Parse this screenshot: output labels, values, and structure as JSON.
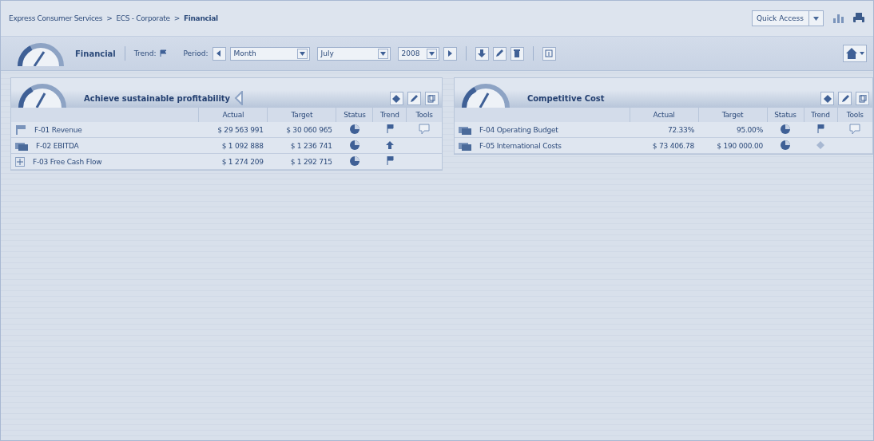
{
  "breadcrumb": {
    "items": [
      {
        "label": "Express Consumer Services",
        "current": false
      },
      {
        "label": "ECS - Corporate",
        "current": false
      },
      {
        "label": "Financial",
        "current": true
      }
    ],
    "separators": [
      ">",
      ">"
    ]
  },
  "quick_access": {
    "value": "Quick Access"
  },
  "toolbar": {
    "title": "Financial",
    "trend_label": "Trend:",
    "period_label": "Period:",
    "selects": [
      {
        "value": "Month"
      },
      {
        "value": "July"
      },
      {
        "value": "2008"
      }
    ]
  },
  "panels": [
    {
      "title": "Achieve sustainable profitability",
      "collapse_arrow": true,
      "columns": [
        "Actual",
        "Target",
        "Status",
        "Trend",
        "Tools"
      ],
      "rows": [
        {
          "name": "F-01 Revenue",
          "actual": "$ 29 563 991",
          "target": "$ 30 060 965",
          "comment": true
        },
        {
          "name": "F-02 EBITDA",
          "actual": "$ 1 092 888",
          "target": "$ 1 236 741",
          "comment": false
        },
        {
          "name": "F-03 Free Cash Flow",
          "actual": "$ 1 274 209",
          "target": "$ 1 292 715",
          "comment": false
        }
      ]
    },
    {
      "title": "Competitive Cost",
      "collapse_arrow": false,
      "columns": [
        "Actual",
        "Target",
        "Status",
        "Trend",
        "Tools"
      ],
      "rows": [
        {
          "name": "F-04 Operating Budget",
          "actual": "72.33%",
          "target": "95.00%",
          "comment": true
        },
        {
          "name": "F-05 International Costs",
          "actual": "$ 73 406.78",
          "target": "$ 190 000.00",
          "comment": false
        }
      ]
    }
  ]
}
